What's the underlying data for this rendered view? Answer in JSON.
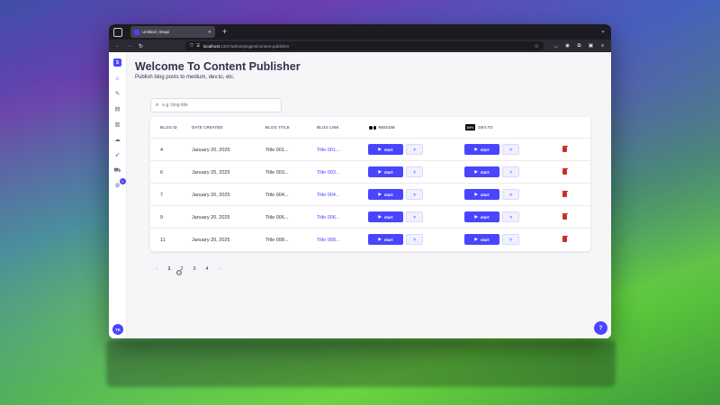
{
  "browser": {
    "tab_title": "Untitled | Strapi",
    "url_host": "localhost",
    "url_path": ":1337/admin/plugins/content-publisher"
  },
  "sidebar": {
    "logo": "S",
    "items": [
      {
        "icon": "home-icon"
      },
      {
        "icon": "pen-icon"
      },
      {
        "icon": "image-icon"
      },
      {
        "icon": "layout-icon"
      },
      {
        "icon": "cloud-icon"
      },
      {
        "icon": "rocket-icon"
      },
      {
        "icon": "cart-icon"
      },
      {
        "icon": "gear-icon",
        "badge": "1"
      }
    ],
    "avatar": "TK"
  },
  "page": {
    "title": "Welcome To Content Publisher",
    "subtitle": "Publish blog posts to medium, dev.to, etc."
  },
  "search": {
    "placeholder": "e.g: blog title"
  },
  "table": {
    "headers": {
      "id": "BLOG ID",
      "date": "DATE CREATED",
      "title": "BLOG TITLE",
      "link": "BLOG LINK",
      "medium": "MEDIUM",
      "devto_logo": "DEV",
      "devto": "DEV.TO"
    },
    "start_label": "start",
    "help_label": "?",
    "rows": [
      {
        "id": "4",
        "date": "January 20, 2025",
        "title": "Title 001...",
        "link": "Title 001..."
      },
      {
        "id": "6",
        "date": "January 20, 2025",
        "title": "Title 003...",
        "link": "Title 003..."
      },
      {
        "id": "7",
        "date": "January 20, 2025",
        "title": "Title 004...",
        "link": "Title 004..."
      },
      {
        "id": "9",
        "date": "January 20, 2025",
        "title": "Title 006...",
        "link": "Title 006..."
      },
      {
        "id": "11",
        "date": "January 20, 2025",
        "title": "Title 008...",
        "link": "Title 008..."
      }
    ]
  },
  "pagination": {
    "prev": "‹",
    "pages": [
      "1",
      "2",
      "3",
      "4"
    ],
    "current": "1",
    "next": "›"
  },
  "help_fab": "?"
}
